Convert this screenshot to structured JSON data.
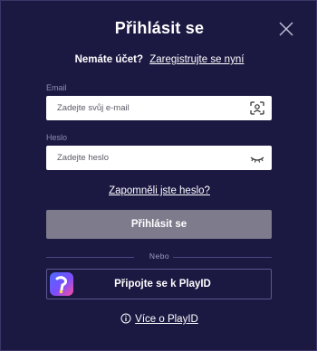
{
  "modal": {
    "title": "Přihlásit se",
    "close_icon": "close-icon"
  },
  "register": {
    "question": "Nemáte účet?",
    "link": "Zaregistrujte se nyní"
  },
  "email": {
    "label": "Email",
    "placeholder": "Zadejte svůj e-mail",
    "value": "",
    "icon": "face-scan-icon"
  },
  "password": {
    "label": "Heslo",
    "placeholder": "Zadejte heslo",
    "value": "",
    "icon": "eye-closed-icon"
  },
  "forgot_password": "Zapomněli jste heslo?",
  "submit_label": "Přihlásit se",
  "divider_label": "Nebo",
  "playid": {
    "button_label": "Připojte se k PlayID",
    "icon": "playid-logo-icon",
    "more_link": "Více o PlayID",
    "info_icon": "info-icon"
  },
  "colors": {
    "background": "#1b1842",
    "submit_disabled": "#7e7b8d",
    "label": "#8f8cb4"
  }
}
